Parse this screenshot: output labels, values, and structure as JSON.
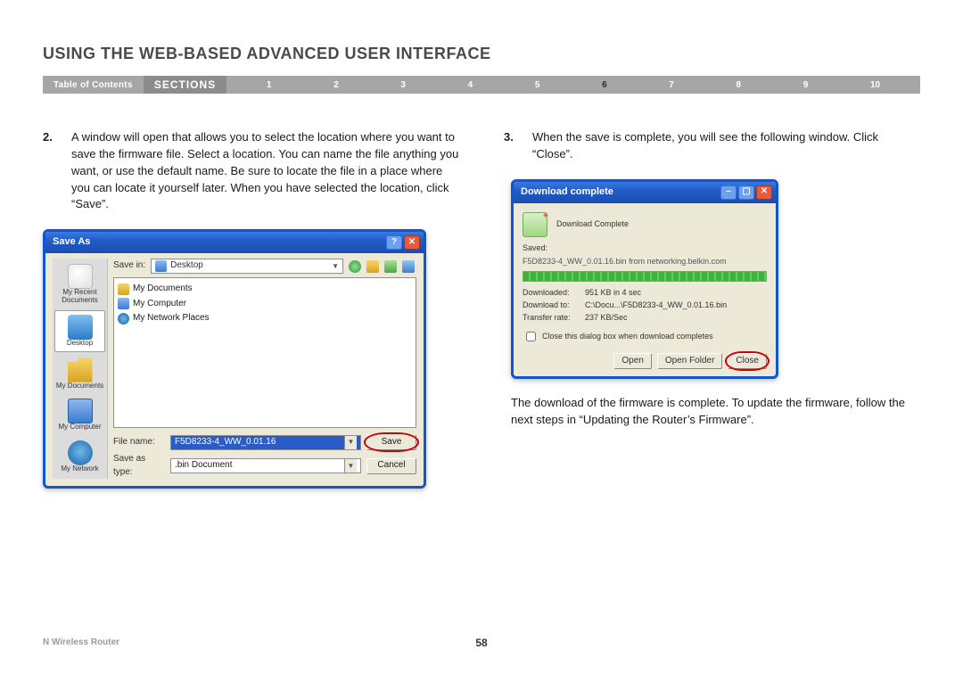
{
  "header": {
    "title": "USING THE WEB-BASED ADVANCED USER INTERFACE",
    "toc": "Table of Contents",
    "sections_label": "SECTIONS",
    "section_numbers": [
      "1",
      "2",
      "3",
      "4",
      "5",
      "6",
      "7",
      "8",
      "9",
      "10"
    ],
    "active_section": "6"
  },
  "steps": {
    "s2": {
      "num": "2.",
      "text": "A window will open that allows you to select the location where you want to save the firmware file. Select a location. You can name the file anything you want, or use the default name. Be sure to locate the file in a place where you can locate it yourself later. When you have selected the location, click “Save”."
    },
    "s3": {
      "num": "3.",
      "text": "When the save is complete, you will see the following window. Click “Close”."
    },
    "post_s3": "The download of the firmware is complete. To update the firmware, follow the next steps in “Updating the Router’s Firmware”."
  },
  "save_as": {
    "title": "Save As",
    "save_in_label": "Save in:",
    "save_in_value": "Desktop",
    "places": [
      {
        "name": "My Recent Documents",
        "iconClass": "ico-recent"
      },
      {
        "name": "Desktop",
        "iconClass": "ico-desktop"
      },
      {
        "name": "My Documents",
        "iconClass": "ico-docs"
      },
      {
        "name": "My Computer",
        "iconClass": "ico-comp"
      },
      {
        "name": "My Network",
        "iconClass": "ico-net"
      }
    ],
    "file_items": [
      {
        "name": "My Documents",
        "iconClass": "fl-folder"
      },
      {
        "name": "My Computer",
        "iconClass": "fl-comp"
      },
      {
        "name": "My Network Places",
        "iconClass": "fl-net"
      }
    ],
    "file_name_label": "File name:",
    "file_name_value": "F5D8233-4_WW_0.01.16",
    "save_type_label": "Save as type:",
    "save_type_value": ".bin Document",
    "save_button": "Save",
    "cancel_button": "Cancel"
  },
  "download_complete": {
    "title": "Download complete",
    "heading": "Download Complete",
    "saved_label": "Saved:",
    "file_line": "F5D8233-4_WW_0.01.16.bin from networking.belkin.com",
    "rows": {
      "downloaded_label": "Downloaded:",
      "downloaded_value": "951 KB in 4 sec",
      "download_to_label": "Download to:",
      "download_to_value": "C:\\Docu...\\F5D8233-4_WW_0.01.16.bin",
      "rate_label": "Transfer rate:",
      "rate_value": "237 KB/Sec"
    },
    "checkbox_label": "Close this dialog box when download completes",
    "buttons": {
      "open": "Open",
      "open_folder": "Open Folder",
      "close": "Close"
    }
  },
  "footer": {
    "product": "N Wireless Router",
    "page_number": "58"
  }
}
